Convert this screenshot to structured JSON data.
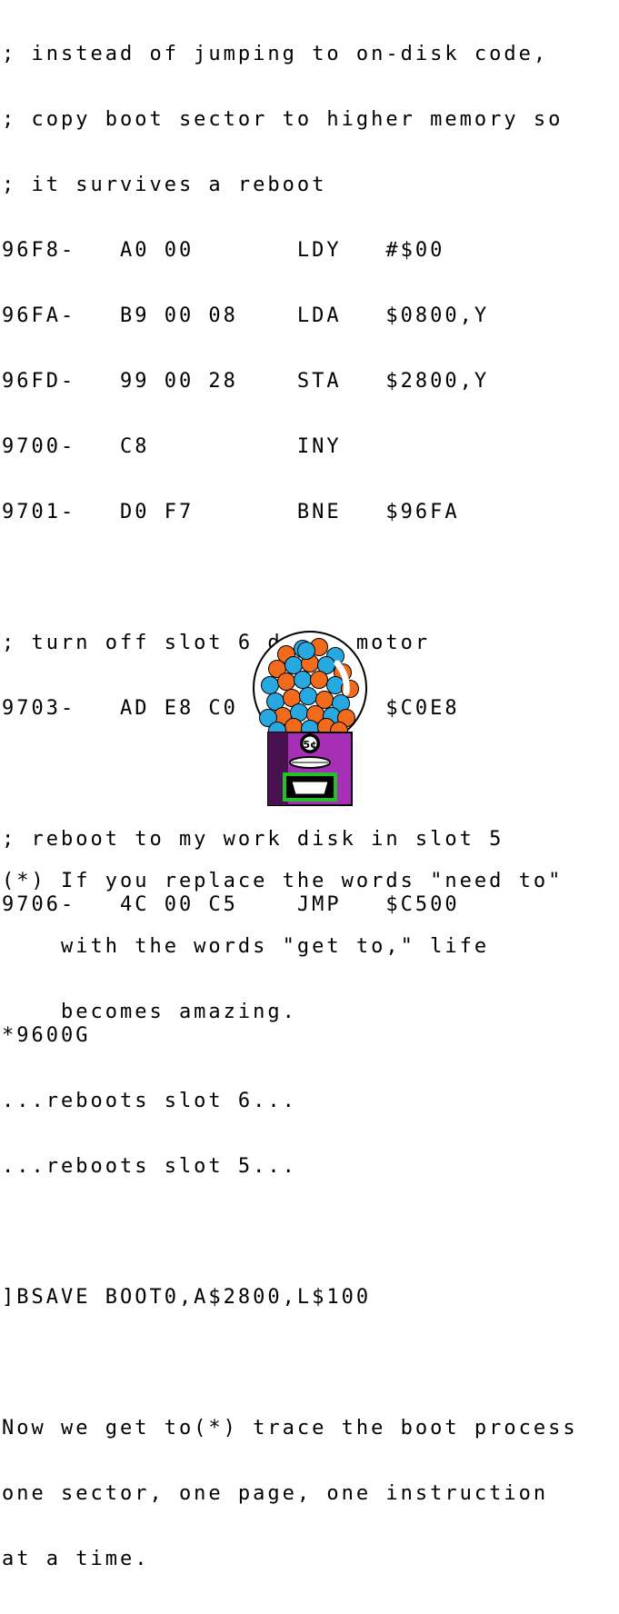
{
  "listing": [
    "; instead of jumping to on-disk code,",
    "; copy boot sector to higher memory so",
    "; it survives a reboot",
    "96F8-   A0 00       LDY   #$00",
    "96FA-   B9 00 08    LDA   $0800,Y",
    "96FD-   99 00 28    STA   $2800,Y",
    "9700-   C8          INY",
    "9701-   D0 F7       BNE   $96FA",
    "",
    "; turn off slot 6 drive motor",
    "9703-   AD E8 C0    LDA   $C0E8",
    "",
    "; reboot to my work disk in slot 5",
    "9706-   4C 00 C5    JMP   $C500",
    "",
    "*9600G",
    "...reboots slot 6...",
    "...reboots slot 5...",
    "",
    "]BSAVE BOOT0,A$2800,L$100",
    "",
    "Now we get to(*) trace the boot process",
    "one sector, one page, one instruction",
    "at a time."
  ],
  "gumball_machine": {
    "coin_label": "5¢",
    "colors": {
      "orange": "#f26a1b",
      "blue": "#28a8e0",
      "purple": "#a72fb5",
      "dark_purple": "#4a1150",
      "green": "#22c12a"
    }
  },
  "footnote": [
    "(*) If you replace the words \"need to\"",
    "    with the words \"get to,\" life",
    "    becomes amazing."
  ]
}
